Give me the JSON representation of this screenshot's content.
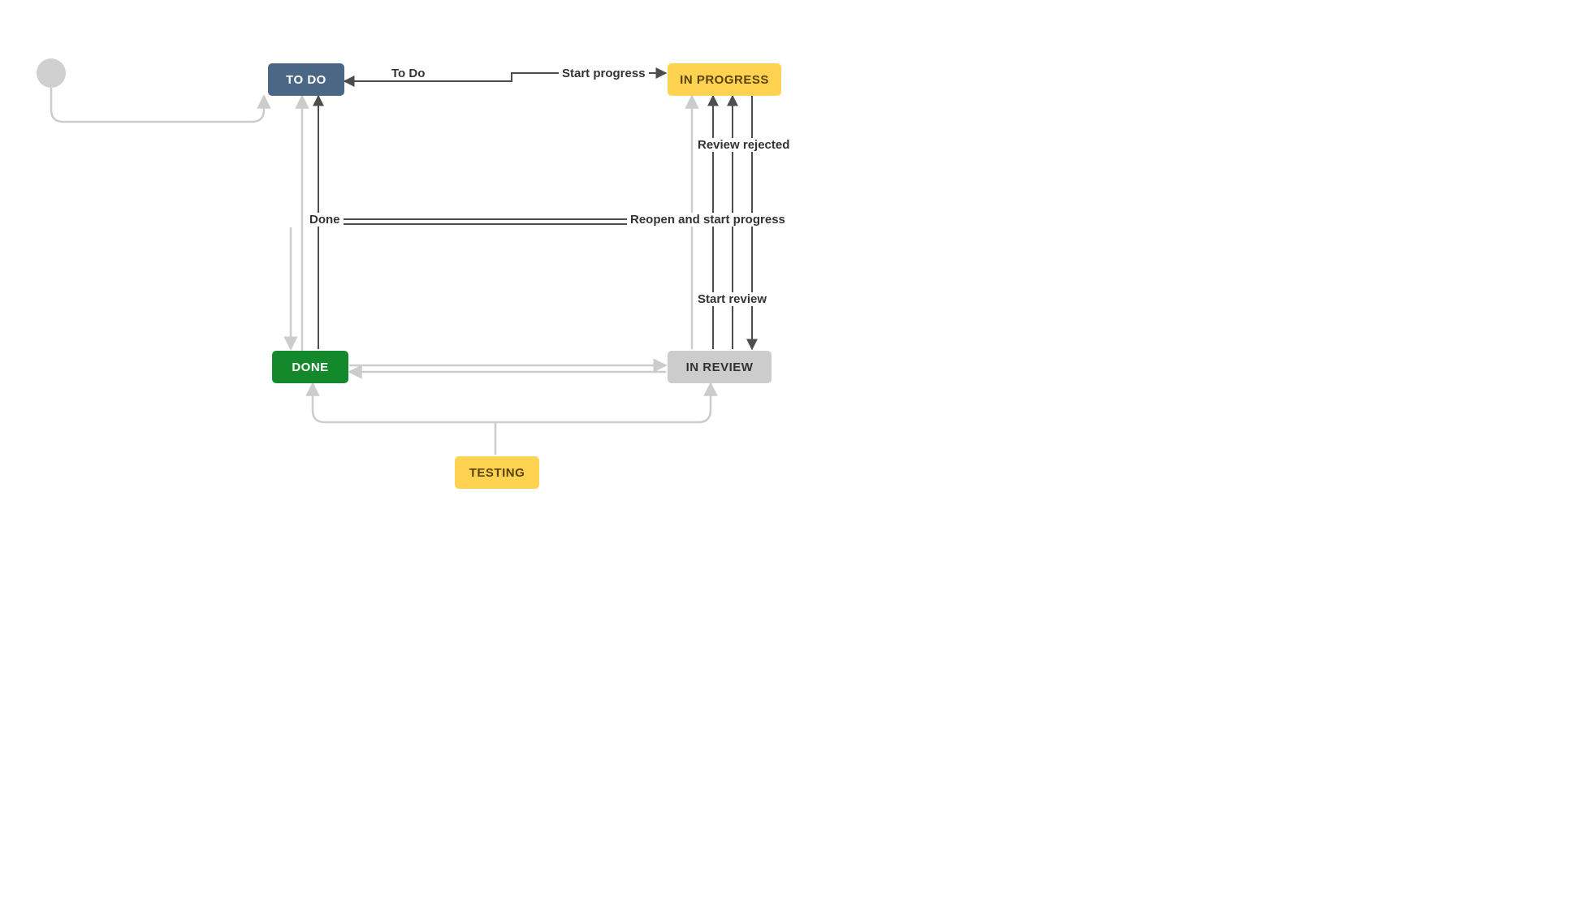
{
  "nodes": {
    "start": {
      "type": "start"
    },
    "todo": {
      "label": "TO DO",
      "kind": "todo"
    },
    "inprogress": {
      "label": "IN PROGRESS",
      "kind": "inprogress"
    },
    "done": {
      "label": "DONE",
      "kind": "done"
    },
    "inreview": {
      "label": "IN REVIEW",
      "kind": "inreview"
    },
    "testing": {
      "label": "TESTING",
      "kind": "testing"
    }
  },
  "transitions": {
    "start_to_todo": {
      "from": "start",
      "to": "todo",
      "label": null,
      "style": "light"
    },
    "inprogress_to_todo": {
      "from": "inprogress",
      "to": "todo",
      "label": "To Do",
      "style": "dark"
    },
    "todo_to_inprogress": {
      "from": "todo",
      "to": "inprogress",
      "label": "Start progress",
      "style": "dark"
    },
    "inreview_to_done": {
      "from": "inreview",
      "to": "done",
      "label": "Done",
      "style": "dark"
    },
    "done_to_inprogress": {
      "from": "done",
      "to": "inprogress",
      "label": "Reopen and start progress",
      "style": "dark"
    },
    "inreview_to_inprogress_a": {
      "from": "inreview",
      "to": "inprogress",
      "label": "Review rejected",
      "style": "dark"
    },
    "inprogress_to_inreview": {
      "from": "inprogress",
      "to": "inreview",
      "label": "Start review",
      "style": "dark"
    },
    "all_to_todo": {
      "from": "*",
      "to": "todo",
      "label": null,
      "style": "light"
    },
    "all_to_done": {
      "from": "*",
      "to": "done",
      "label": null,
      "style": "light"
    },
    "all_to_inprogress": {
      "from": "*",
      "to": "inprogress",
      "label": null,
      "style": "light"
    },
    "all_to_inreview": {
      "from": "*",
      "to": "inreview",
      "label": null,
      "style": "light"
    },
    "testing_to_done": {
      "from": "testing",
      "to": "done",
      "label": null,
      "style": "light"
    },
    "testing_to_inreview": {
      "from": "testing",
      "to": "inreview",
      "label": null,
      "style": "light"
    }
  },
  "colors": {
    "todo_bg": "#4a6785",
    "inprogress_bg": "#ffd351",
    "done_bg": "#14892c",
    "inreview_bg": "#cccccc",
    "testing_bg": "#ffd351",
    "dark_line": "#4d4d4d",
    "light_line": "#cccccc"
  }
}
